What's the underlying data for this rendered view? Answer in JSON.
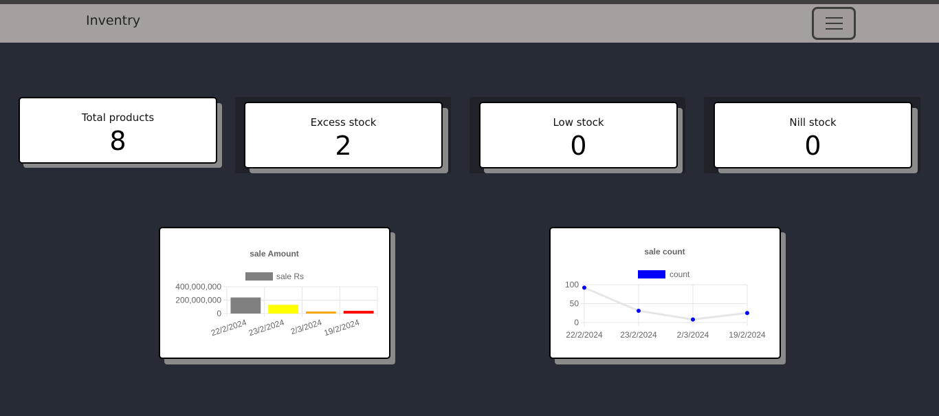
{
  "navbar": {
    "brand": "Inventry",
    "menu_icon": "hamburger-menu-icon"
  },
  "stats": [
    {
      "label": "Total products",
      "value": "8"
    },
    {
      "label": "Excess stock",
      "value": "2"
    },
    {
      "label": "Low stock",
      "value": "0"
    },
    {
      "label": "Nill stock",
      "value": "0"
    }
  ],
  "chart_data": [
    {
      "type": "bar",
      "title": "sale Amount",
      "categories": [
        "22/2/2024",
        "23/2/2024",
        "2/3/2024",
        "19/2/2024"
      ],
      "series": [
        {
          "name": "sale Rs",
          "values": [
            240000000,
            130000000,
            30000000,
            40000000
          ]
        }
      ],
      "bar_colors": [
        "#808080",
        "#ffff00",
        "#ffa500",
        "#ff0000"
      ],
      "legend_color": "#808080",
      "yticks": [
        "400,000,000",
        "200,000,000",
        "0"
      ],
      "ylim": [
        0,
        400000000
      ],
      "grid": true,
      "legend": "top"
    },
    {
      "type": "line",
      "title": "sale count",
      "categories": [
        "22/2/2024",
        "23/2/2024",
        "2/3/2024",
        "19/2/2024"
      ],
      "series": [
        {
          "name": "count",
          "values": [
            92,
            31,
            8,
            25
          ]
        }
      ],
      "line_color": "#e6e6e6",
      "point_color": "#0000ff",
      "legend_color": "#0000ff",
      "yticks": [
        "100",
        "50",
        "0"
      ],
      "ylim": [
        0,
        100
      ],
      "grid": true,
      "legend": "top"
    }
  ]
}
